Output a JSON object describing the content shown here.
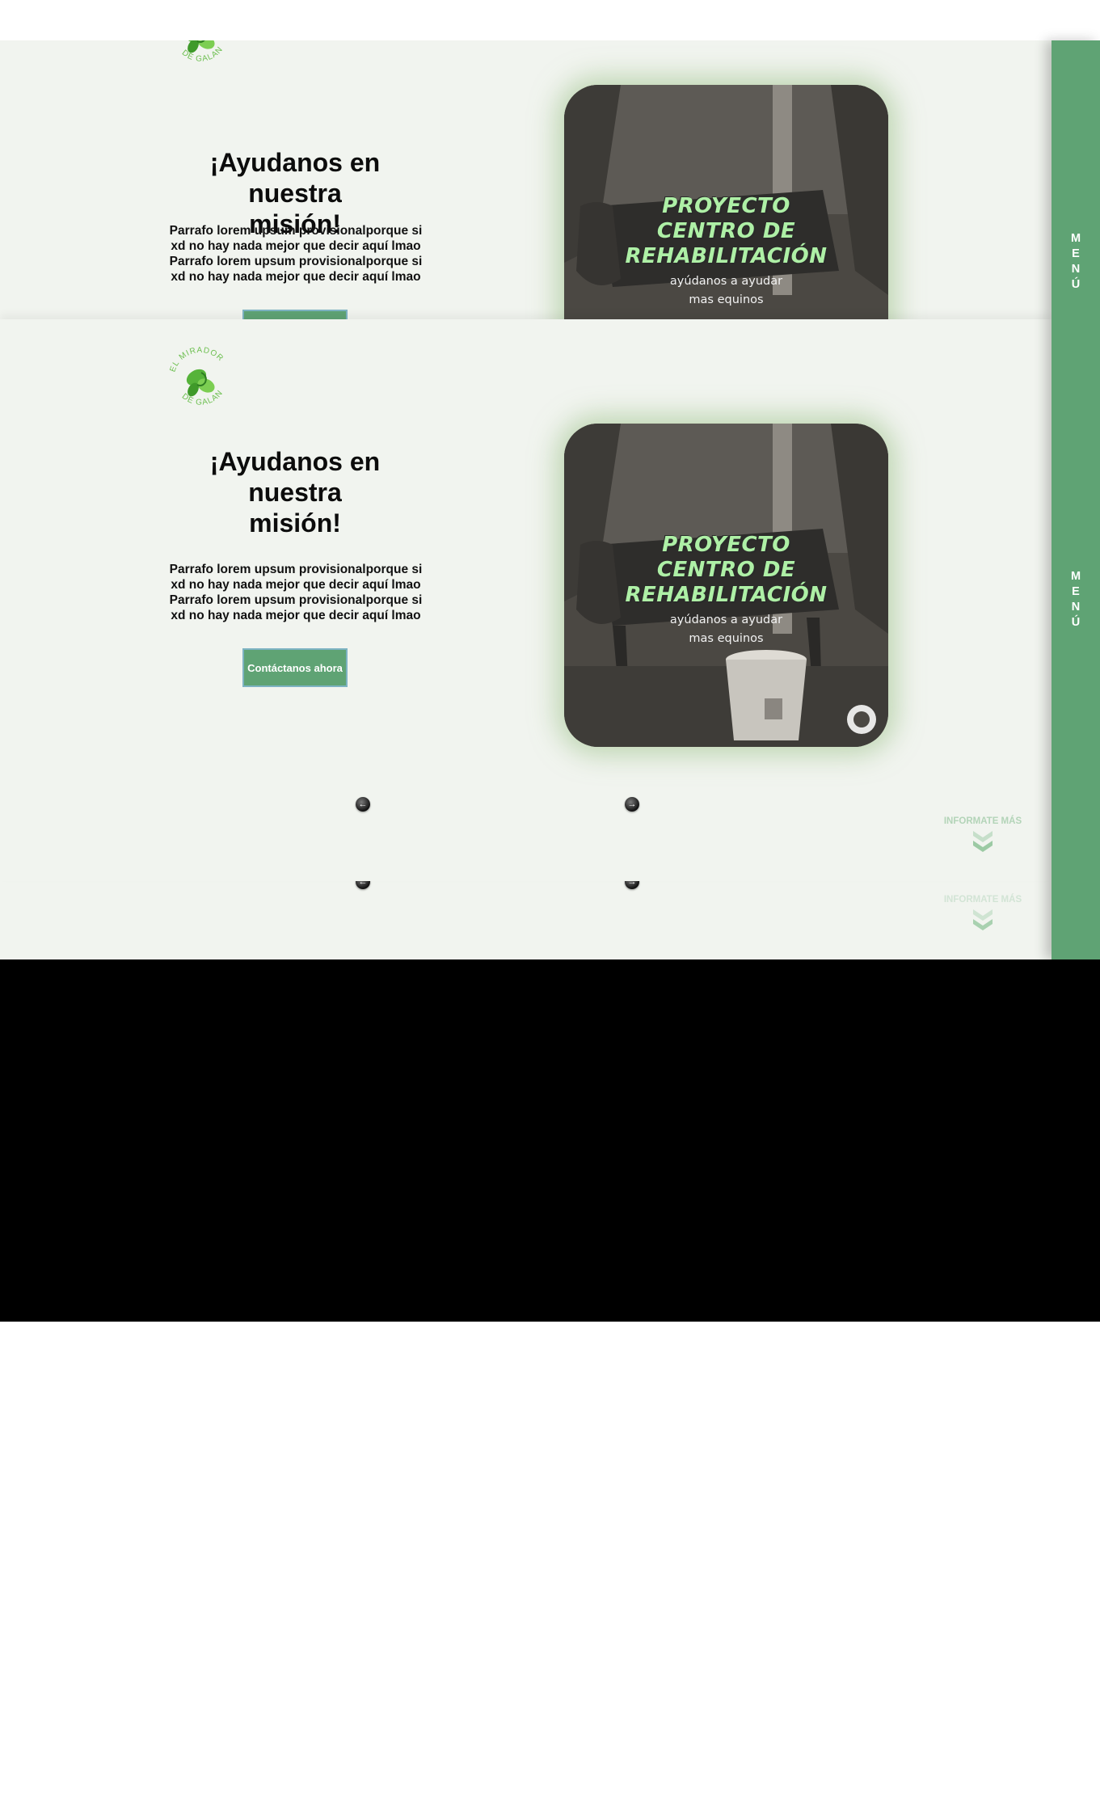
{
  "brand": {
    "logo_line1": "EL MIRADOR",
    "logo_line2": "DE GALAN"
  },
  "hero": {
    "heading_line1": "¡Ayudanos en nuestra",
    "heading_line2": "misión!",
    "paragraph_lines": [
      "Parrafo lorem upsum provisionalporque si",
      "xd no hay nada mejor que decir aquí lmao",
      "Parrafo lorem upsum provisionalporque si",
      "xd no hay nada mejor que decir aquí lmao"
    ],
    "cta_label": "Contáctanos ahora"
  },
  "poster": {
    "title_lines": [
      "PROYECTO",
      "CENTRO DE",
      "REHABILITACIÓN"
    ],
    "subtitle_lines": [
      "ayúdanos a ayudar",
      "mas equinos"
    ]
  },
  "carousel": {
    "prev_icon": "arrow-left-icon",
    "next_icon": "arrow-right-icon"
  },
  "scroll_hint": {
    "label": "INFORMATE MÁS",
    "icon": "double-chevron-down-icon"
  },
  "menu": {
    "letters": [
      "M",
      "E",
      "N",
      "Ú"
    ]
  },
  "colors": {
    "accent_green": "#5fa374",
    "panel_bg": "#f1f4ef",
    "poster_title": "#aef0a6",
    "button_border": "#7db3c2"
  }
}
